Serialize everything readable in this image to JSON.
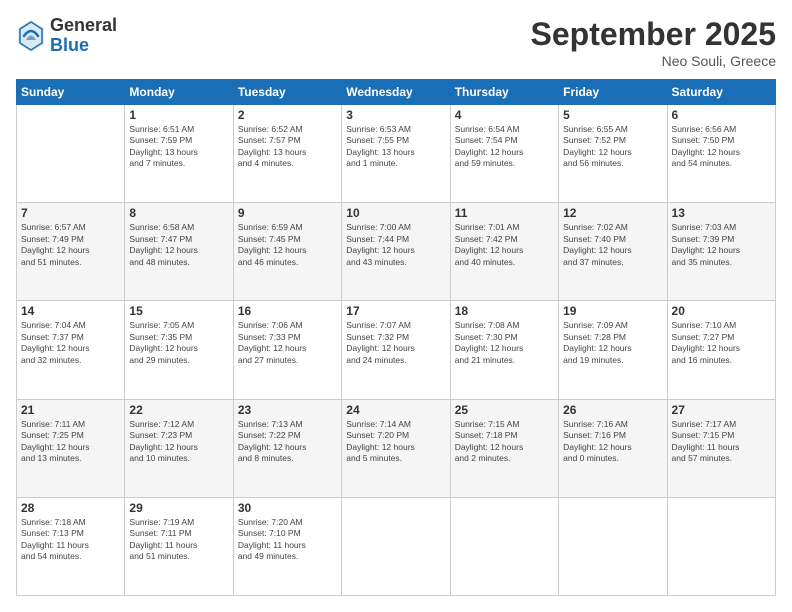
{
  "logo": {
    "general": "General",
    "blue": "Blue"
  },
  "header": {
    "title": "September 2025",
    "subtitle": "Neo Souli, Greece"
  },
  "weekdays": [
    "Sunday",
    "Monday",
    "Tuesday",
    "Wednesday",
    "Thursday",
    "Friday",
    "Saturday"
  ],
  "weeks": [
    [
      {
        "day": "",
        "info": ""
      },
      {
        "day": "1",
        "info": "Sunrise: 6:51 AM\nSunset: 7:59 PM\nDaylight: 13 hours\nand 7 minutes."
      },
      {
        "day": "2",
        "info": "Sunrise: 6:52 AM\nSunset: 7:57 PM\nDaylight: 13 hours\nand 4 minutes."
      },
      {
        "day": "3",
        "info": "Sunrise: 6:53 AM\nSunset: 7:55 PM\nDaylight: 13 hours\nand 1 minute."
      },
      {
        "day": "4",
        "info": "Sunrise: 6:54 AM\nSunset: 7:54 PM\nDaylight: 12 hours\nand 59 minutes."
      },
      {
        "day": "5",
        "info": "Sunrise: 6:55 AM\nSunset: 7:52 PM\nDaylight: 12 hours\nand 56 minutes."
      },
      {
        "day": "6",
        "info": "Sunrise: 6:56 AM\nSunset: 7:50 PM\nDaylight: 12 hours\nand 54 minutes."
      }
    ],
    [
      {
        "day": "7",
        "info": "Sunrise: 6:57 AM\nSunset: 7:49 PM\nDaylight: 12 hours\nand 51 minutes."
      },
      {
        "day": "8",
        "info": "Sunrise: 6:58 AM\nSunset: 7:47 PM\nDaylight: 12 hours\nand 48 minutes."
      },
      {
        "day": "9",
        "info": "Sunrise: 6:59 AM\nSunset: 7:45 PM\nDaylight: 12 hours\nand 46 minutes."
      },
      {
        "day": "10",
        "info": "Sunrise: 7:00 AM\nSunset: 7:44 PM\nDaylight: 12 hours\nand 43 minutes."
      },
      {
        "day": "11",
        "info": "Sunrise: 7:01 AM\nSunset: 7:42 PM\nDaylight: 12 hours\nand 40 minutes."
      },
      {
        "day": "12",
        "info": "Sunrise: 7:02 AM\nSunset: 7:40 PM\nDaylight: 12 hours\nand 37 minutes."
      },
      {
        "day": "13",
        "info": "Sunrise: 7:03 AM\nSunset: 7:39 PM\nDaylight: 12 hours\nand 35 minutes."
      }
    ],
    [
      {
        "day": "14",
        "info": "Sunrise: 7:04 AM\nSunset: 7:37 PM\nDaylight: 12 hours\nand 32 minutes."
      },
      {
        "day": "15",
        "info": "Sunrise: 7:05 AM\nSunset: 7:35 PM\nDaylight: 12 hours\nand 29 minutes."
      },
      {
        "day": "16",
        "info": "Sunrise: 7:06 AM\nSunset: 7:33 PM\nDaylight: 12 hours\nand 27 minutes."
      },
      {
        "day": "17",
        "info": "Sunrise: 7:07 AM\nSunset: 7:32 PM\nDaylight: 12 hours\nand 24 minutes."
      },
      {
        "day": "18",
        "info": "Sunrise: 7:08 AM\nSunset: 7:30 PM\nDaylight: 12 hours\nand 21 minutes."
      },
      {
        "day": "19",
        "info": "Sunrise: 7:09 AM\nSunset: 7:28 PM\nDaylight: 12 hours\nand 19 minutes."
      },
      {
        "day": "20",
        "info": "Sunrise: 7:10 AM\nSunset: 7:27 PM\nDaylight: 12 hours\nand 16 minutes."
      }
    ],
    [
      {
        "day": "21",
        "info": "Sunrise: 7:11 AM\nSunset: 7:25 PM\nDaylight: 12 hours\nand 13 minutes."
      },
      {
        "day": "22",
        "info": "Sunrise: 7:12 AM\nSunset: 7:23 PM\nDaylight: 12 hours\nand 10 minutes."
      },
      {
        "day": "23",
        "info": "Sunrise: 7:13 AM\nSunset: 7:22 PM\nDaylight: 12 hours\nand 8 minutes."
      },
      {
        "day": "24",
        "info": "Sunrise: 7:14 AM\nSunset: 7:20 PM\nDaylight: 12 hours\nand 5 minutes."
      },
      {
        "day": "25",
        "info": "Sunrise: 7:15 AM\nSunset: 7:18 PM\nDaylight: 12 hours\nand 2 minutes."
      },
      {
        "day": "26",
        "info": "Sunrise: 7:16 AM\nSunset: 7:16 PM\nDaylight: 12 hours\nand 0 minutes."
      },
      {
        "day": "27",
        "info": "Sunrise: 7:17 AM\nSunset: 7:15 PM\nDaylight: 11 hours\nand 57 minutes."
      }
    ],
    [
      {
        "day": "28",
        "info": "Sunrise: 7:18 AM\nSunset: 7:13 PM\nDaylight: 11 hours\nand 54 minutes."
      },
      {
        "day": "29",
        "info": "Sunrise: 7:19 AM\nSunset: 7:11 PM\nDaylight: 11 hours\nand 51 minutes."
      },
      {
        "day": "30",
        "info": "Sunrise: 7:20 AM\nSunset: 7:10 PM\nDaylight: 11 hours\nand 49 minutes."
      },
      {
        "day": "",
        "info": ""
      },
      {
        "day": "",
        "info": ""
      },
      {
        "day": "",
        "info": ""
      },
      {
        "day": "",
        "info": ""
      }
    ]
  ]
}
